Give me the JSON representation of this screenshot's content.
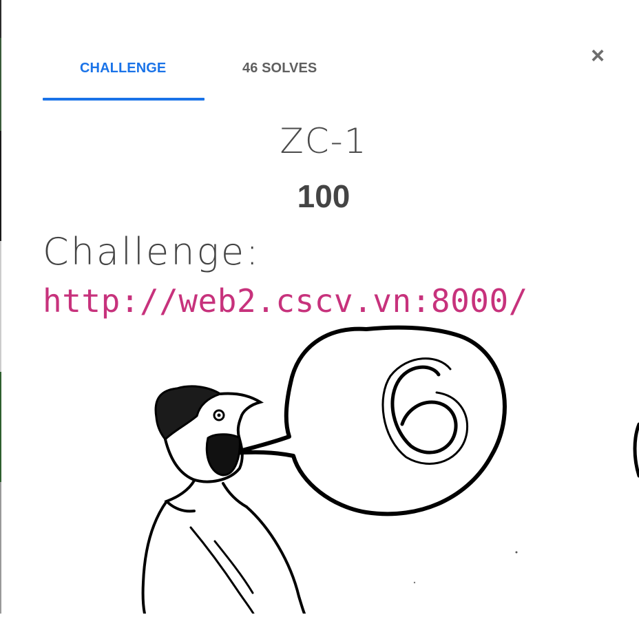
{
  "tabs": [
    {
      "label": "CHALLENGE",
      "active": true
    },
    {
      "label": "46 SOLVES",
      "active": false
    }
  ],
  "close_label": "×",
  "challenge": {
    "name": "ZC-1",
    "points": "100",
    "description_heading": "Challenge:",
    "url": "http://web2.cscv.vn:8000/"
  },
  "image": {
    "icon": "cartoon-man-speech-bubble-six",
    "bubble_text": "6"
  },
  "colors": {
    "accent": "#1a73e8",
    "link": "#c7327c",
    "text": "#444444"
  }
}
